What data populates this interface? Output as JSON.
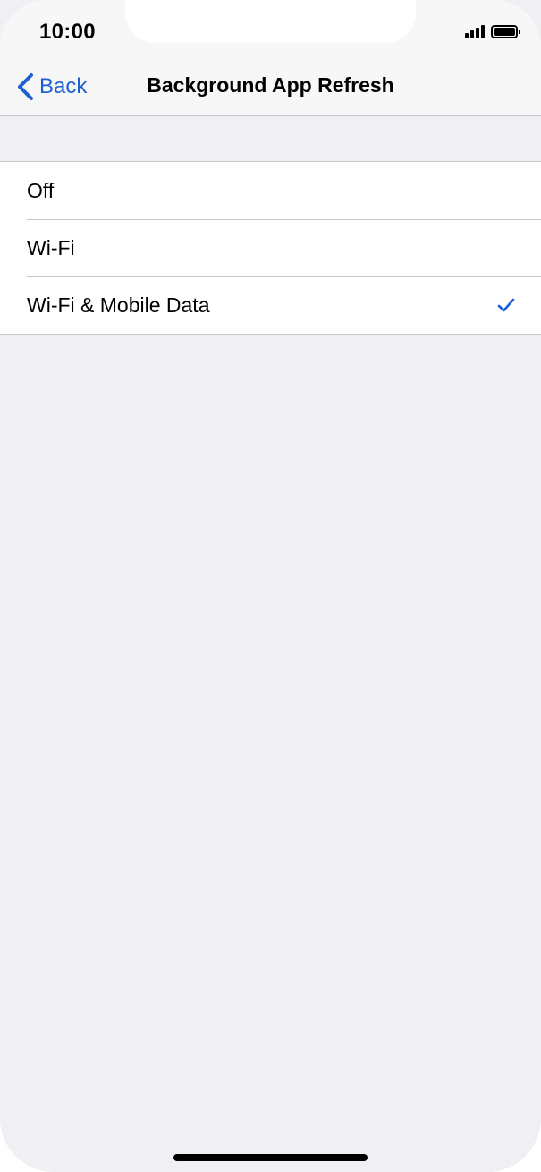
{
  "status_bar": {
    "time": "10:00"
  },
  "nav": {
    "back_label": "Back",
    "title": "Background App Refresh"
  },
  "options": [
    {
      "label": "Off",
      "selected": false
    },
    {
      "label": "Wi-Fi",
      "selected": false
    },
    {
      "label": "Wi-Fi & Mobile Data",
      "selected": true
    }
  ],
  "colors": {
    "accent": "#1e5fd1",
    "background": "#efeff4",
    "separator": "#c6c6c8",
    "nav_background": "#f7f7f7"
  },
  "icons": {
    "back": "chevron-left-icon",
    "selected": "checkmark-icon",
    "signal": "cellular-signal-icon",
    "battery": "battery-icon"
  }
}
